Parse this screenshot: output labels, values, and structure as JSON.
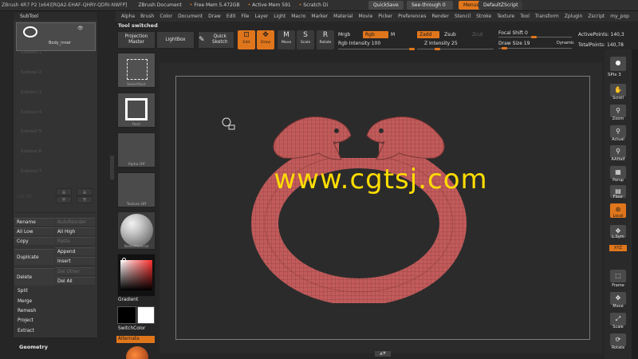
{
  "titlebar": {
    "app": "ZBrush 4R7 P2 (x64)[RQA2-EHAF-QHRY-QDRI-NWFP]",
    "doc": "ZBrush Document",
    "free_mem": "Free Mem 5.472GB",
    "active_mem": "Active Mem 591",
    "scratch": "Scratch Di",
    "quicksave": "QuickSave",
    "see_through": "See-through  0",
    "menus": "Menus",
    "script": "DefaultZScript"
  },
  "menubar": [
    "Alpha",
    "Brush",
    "Color",
    "Document",
    "Draw",
    "Edit",
    "File",
    "Layer",
    "Light",
    "Macro",
    "Marker",
    "Material",
    "Movie",
    "Picker",
    "Preferences",
    "Render",
    "Stencil",
    "Stroke",
    "Texture",
    "Tool",
    "Transform",
    "Zplugin",
    "Zscript",
    "my_pop"
  ],
  "status": "Tool switched",
  "subtool": {
    "title": "SubTool",
    "active_name": "Body_inner",
    "slots": [
      "Subtool 1",
      "Subtool 2",
      "Subtool 3",
      "Subtool 4",
      "Subtool 5",
      "Subtool 6",
      "Subtool 7"
    ],
    "list_all": "List All",
    "buttons": {
      "rename": "Rename",
      "autoreorder": "AutoReorder",
      "all_low": "All Low",
      "all_high": "All High",
      "copy": "Copy",
      "paste": "Paste",
      "duplicate": "Duplicate",
      "append": "Append",
      "insert": "Insert",
      "delete": "Delete",
      "del_other": "Del Other",
      "del_all": "Del All",
      "split": "Split",
      "merge": "Merge",
      "remesh": "Remesh",
      "project": "Project",
      "extract": "Extract"
    },
    "geometry": "Geometry"
  },
  "tools": {
    "seltrace": "SelectRect",
    "rect": "Rect",
    "alpha": "Alpha Off",
    "texture": "Texture Off",
    "material": "BasicMaterial",
    "gradient": "Gradient",
    "switchcolor": "SwitchColor",
    "alternate": "Alternate"
  },
  "shelf": {
    "projection_master": "Projection Master",
    "lightbox": "LightBox",
    "quick_sketch": "Quick Sketch",
    "edit": "Edit",
    "draw": "Draw",
    "move": "Move",
    "scale": "Scale",
    "rotate": "Rotate",
    "mrgb": "Mrgb",
    "rgb": "Rgb",
    "m": "M",
    "zadd": "Zadd",
    "zsub": "Zsub",
    "zcut": "Zcut",
    "rgb_intensity": "Rgb Intensity 100",
    "z_intensity": "Z Intensity 25",
    "focal_shift": "Focal Shift 0",
    "draw_size": "Draw Size 19",
    "dynamic": "Dynamic",
    "active_points": "ActivePoints: 140,3",
    "total_points": "TotalPoints: 140,78"
  },
  "watermark": "www.cgtsj.com",
  "nav": {
    "spix": "SPix 3",
    "scroll": "Scroll",
    "zoom": "Zoom",
    "actual": "Actual",
    "aahalf": "AAHalf",
    "persp": "Persp",
    "floor": "Floor",
    "local": "Local",
    "lsym": "L.Sym",
    "xyz": "XYZ",
    "frame": "Frame",
    "move": "Move",
    "scale": "Scale",
    "rotate": "Rotate"
  },
  "colors": {
    "accent": "#e0761c",
    "model": "#c25b5b",
    "watermark": "#ffdd00"
  }
}
